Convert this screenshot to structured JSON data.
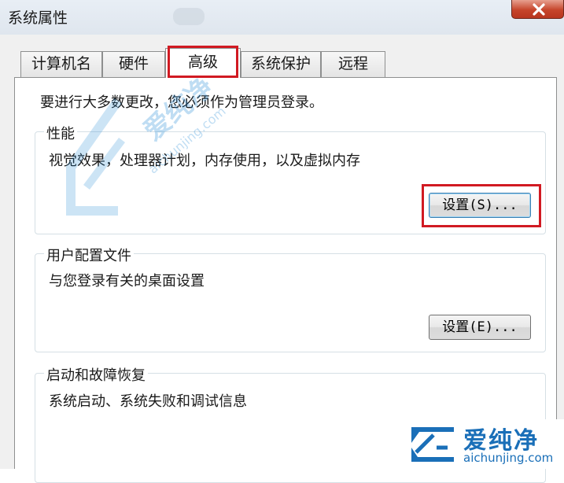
{
  "window": {
    "title": "系统属性",
    "close_label": "×"
  },
  "tabs": [
    {
      "label": "计算机名",
      "active": false
    },
    {
      "label": "硬件",
      "active": false
    },
    {
      "label": "高级",
      "active": true
    },
    {
      "label": "系统保护",
      "active": false
    },
    {
      "label": "远程",
      "active": false
    }
  ],
  "advanced": {
    "intro": "要进行大多数更改，您必须作为管理员登录。",
    "performance": {
      "legend": "性能",
      "description": "视觉效果，处理器计划，内存使用，以及虚拟内存",
      "button_label": "设置(S)..."
    },
    "user_profiles": {
      "legend": "用户配置文件",
      "description": "与您登录有关的桌面设置",
      "button_label": "设置(E)..."
    },
    "startup_recovery": {
      "legend": "启动和故障恢复",
      "description": "系统启动、系统失败和调试信息"
    }
  },
  "watermark": {
    "name": "爱纯净",
    "url": "aichunjing.com"
  },
  "colors": {
    "highlight": "#d11a22",
    "watermark": "#1a6fb8",
    "close_button": "#c6452b"
  },
  "icons": [
    "close-icon",
    "logo-icon"
  ]
}
